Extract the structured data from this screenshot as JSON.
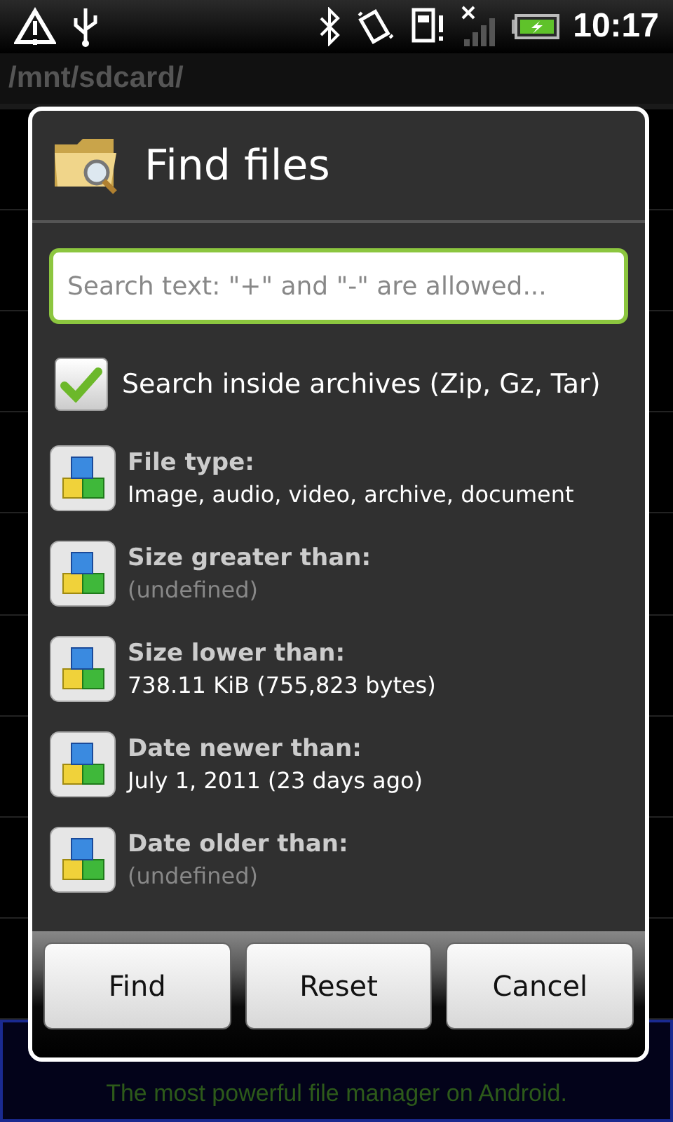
{
  "status_bar": {
    "time": "10:17"
  },
  "path_bar": {
    "path": "/mnt/sdcard/"
  },
  "banner": {
    "tagline": "The most powerful file manager on Android."
  },
  "dialog": {
    "title": "Find files",
    "search": {
      "placeholder": "Search text: \"+\" and \"-\" are allowed..."
    },
    "archive_option": {
      "label": "Search inside archives (Zip, Gz, Tar)",
      "checked": true
    },
    "options": [
      {
        "label": "File type:",
        "value": "Image, audio, video, archive, document",
        "defined": true
      },
      {
        "label": "Size greater than:",
        "value": "(undefined)",
        "defined": false
      },
      {
        "label": "Size lower than:",
        "value": "738.11 KiB (755,823 bytes)",
        "defined": true
      },
      {
        "label": "Date newer than:",
        "value": "July 1, 2011 (23 days ago)",
        "defined": true
      },
      {
        "label": "Date older than:",
        "value": "(undefined)",
        "defined": false
      }
    ],
    "buttons": [
      "Find",
      "Reset",
      "Cancel"
    ]
  }
}
